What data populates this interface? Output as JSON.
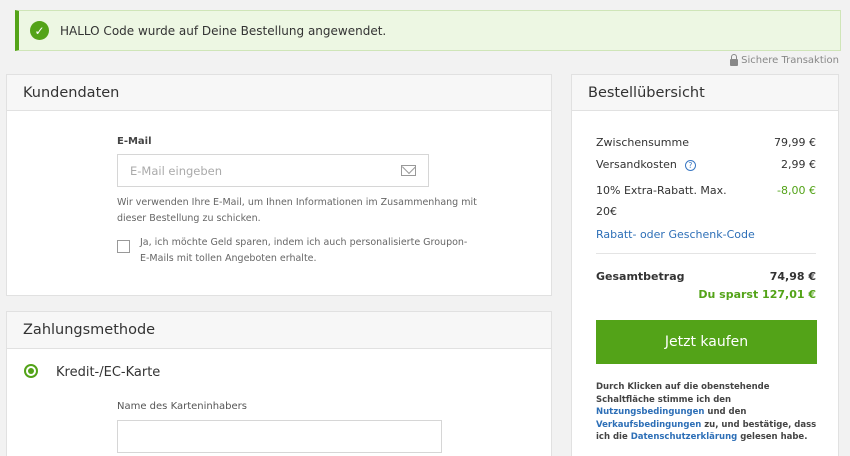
{
  "banner": {
    "message": "HALLO Code wurde auf Deine Bestellung angewendet."
  },
  "secure_label": "Sichere Transaktion",
  "customer": {
    "title": "Kundendaten",
    "email_label": "E-Mail",
    "email_placeholder": "E-Mail eingeben",
    "email_help_1": "Wir verwenden Ihre E-Mail, um Ihnen Informationen im Zusammenhang mit",
    "email_help_2": "dieser Bestellung zu schicken.",
    "optin_1": "Ja, ich möchte Geld sparen, indem ich auch personalisierte Groupon-",
    "optin_2": "E-Mails mit tollen Angeboten erhalte."
  },
  "payment": {
    "title": "Zahlungsmethode",
    "method": "Kredit-/EC-Karte",
    "cardholder_label": "Name des Karteninhabers"
  },
  "summary": {
    "title": "Bestellübersicht",
    "subtotal_label": "Zwischensumme",
    "subtotal_value": "79,99 €",
    "shipping_label": "Versandkosten",
    "shipping_value": "2,99 €",
    "discount_label_1": "10% Extra-Rabatt. Max.",
    "discount_label_2": "20€",
    "discount_value": "-8,00 €",
    "code_link": "Rabatt- oder Geschenk-Code",
    "total_label": "Gesamtbetrag",
    "total_value": "74,98 €",
    "savings": "Du sparst 127,01 €",
    "buy_button": "Jetzt kaufen",
    "legal_1": "Durch Klicken auf die obenstehende Schaltfläche stimme ich den",
    "legal_terms": "Nutzungsbedingungen",
    "legal_2": "und den",
    "legal_sales": "Verkaufsbedingungen",
    "legal_3": "zu, und bestätige, dass ich die",
    "legal_privacy": "Datenschutzerklärung",
    "legal_4": "gelesen habe."
  },
  "colors": {
    "accent": "#53a318",
    "link": "#2d6fb7"
  }
}
